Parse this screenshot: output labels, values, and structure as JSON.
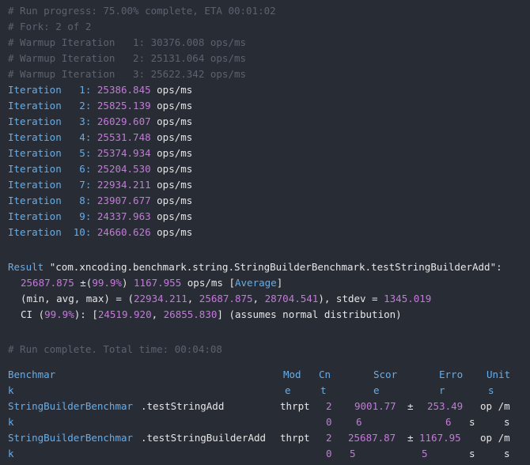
{
  "log": {
    "progress": "# Run progress: 75.00% complete, ETA 00:01:02",
    "fork": "# Fork: 2 of 2",
    "warmups": [
      "# Warmup Iteration   1: 30376.008 ops/ms",
      "# Warmup Iteration   2: 25131.064 ops/ms",
      "# Warmup Iteration   3: 25622.342 ops/ms"
    ],
    "iterations": [
      {
        "label": "Iteration   1:",
        "value": "25386.845",
        "unit": "ops/ms"
      },
      {
        "label": "Iteration   2:",
        "value": "25825.139",
        "unit": "ops/ms"
      },
      {
        "label": "Iteration   3:",
        "value": "26029.607",
        "unit": "ops/ms"
      },
      {
        "label": "Iteration   4:",
        "value": "25531.748",
        "unit": "ops/ms"
      },
      {
        "label": "Iteration   5:",
        "value": "25374.934",
        "unit": "ops/ms"
      },
      {
        "label": "Iteration   6:",
        "value": "25204.530",
        "unit": "ops/ms"
      },
      {
        "label": "Iteration   7:",
        "value": "22934.211",
        "unit": "ops/ms"
      },
      {
        "label": "Iteration   8:",
        "value": "23907.677",
        "unit": "ops/ms"
      },
      {
        "label": "Iteration   9:",
        "value": "24337.963",
        "unit": "ops/ms"
      },
      {
        "label": "Iteration  10:",
        "value": "24660.626",
        "unit": "ops/ms"
      }
    ]
  },
  "result": {
    "label": "Result",
    "benchmark": "\"com.xncoding.benchmark.string.StringBuilderBenchmark.testStringBuilderAdd\"",
    "colon": ":",
    "score": "25687.875",
    "pm": "±(",
    "confidence": "99.9%",
    "pm_close": ")",
    "error": "1167.955",
    "unit": "ops/ms",
    "bracket_open": "[",
    "mode": "Average",
    "bracket_close": "]",
    "minmax_label": "(min, avg, max) = (",
    "min": "22934.211",
    "sep1": ", ",
    "avg": "25687.875",
    "sep2": ", ",
    "max": "28704.541",
    "stdev_label": "), stdev = ",
    "stdev": "1345.019",
    "ci_label": "CI (",
    "ci_conf": "99.9%",
    "ci_mid": "): [",
    "ci_low": "24519.920",
    "ci_sep": ", ",
    "ci_high": "26855.830",
    "ci_tail": "] (assumes normal distribution)"
  },
  "complete": "# Run complete. Total time: 00:04:08",
  "table": {
    "headers": {
      "benchmark": [
        "Benchmar",
        "k"
      ],
      "mode": [
        "Mod",
        "e"
      ],
      "cnt": [
        "Cn",
        "t"
      ],
      "score": [
        "Scor",
        "e"
      ],
      "error": [
        "Erro",
        "r"
      ],
      "units": [
        "Unit",
        "s"
      ]
    },
    "rows": [
      {
        "class_name": [
          "StringBuilderBenchmar",
          "k"
        ],
        "method": ".testStringAdd",
        "mode": "thrpt",
        "cnt": [
          "2",
          "0"
        ],
        "score": [
          "9001.77",
          "6"
        ],
        "pm": "±",
        "error": [
          "253.49",
          "6"
        ],
        "s_col": "s",
        "units": [
          "op /m",
          "s"
        ]
      },
      {
        "class_name": [
          "StringBuilderBenchmar",
          "k"
        ],
        "method": ".testStringBuilderAdd",
        "mode": "thrpt",
        "cnt": [
          "2",
          "0"
        ],
        "score": [
          "25687.87",
          "5"
        ],
        "pm": "±",
        "error": [
          "1167.95",
          "5"
        ],
        "s_col": "s",
        "units": [
          "op /m",
          "s"
        ]
      }
    ]
  },
  "colors": {
    "background": "#282c34",
    "comment": "#5c6370",
    "keyword_blue": "#61afef",
    "number_purple": "#c678dd",
    "text": "#e6e6e6"
  }
}
